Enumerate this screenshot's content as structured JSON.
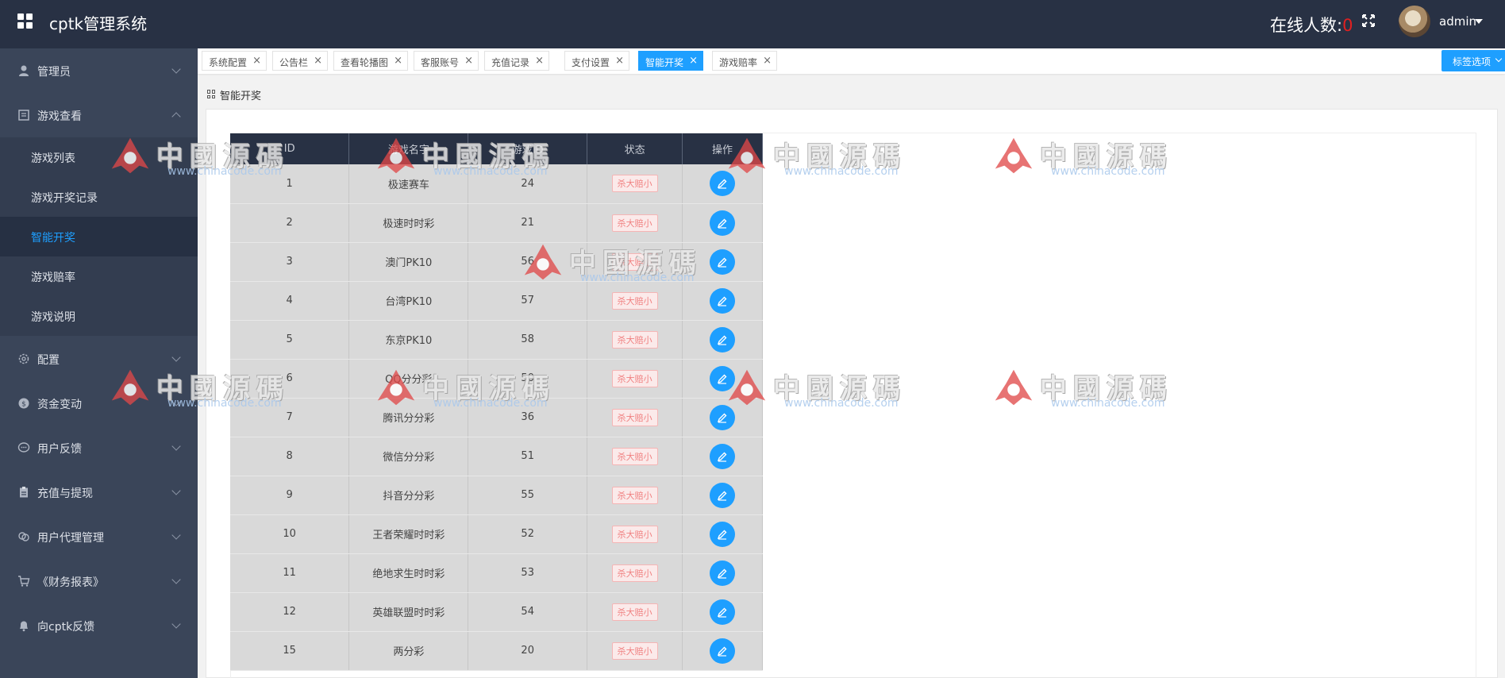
{
  "header": {
    "title": "cptk管理系统",
    "online_label": "在线人数:",
    "online_count": "0",
    "user": "admin"
  },
  "sidebar": {
    "items": [
      {
        "label": "管理员",
        "icon": "user-icon"
      },
      {
        "label": "游戏查看",
        "icon": "book-icon",
        "expanded": true,
        "children": [
          {
            "label": "游戏列表"
          },
          {
            "label": "游戏开奖记录"
          },
          {
            "label": "智能开奖",
            "active": true
          },
          {
            "label": "游戏赔率"
          },
          {
            "label": "游戏说明"
          }
        ]
      },
      {
        "label": "配置",
        "icon": "gear-icon"
      },
      {
        "label": "资金变动",
        "icon": "coin-icon"
      },
      {
        "label": "用户反馈",
        "icon": "chat-icon"
      },
      {
        "label": "充值与提现",
        "icon": "clipboard-icon"
      },
      {
        "label": "用户代理管理",
        "icon": "link-icon"
      },
      {
        "label": "《财务报表》",
        "icon": "cart-icon"
      },
      {
        "label": "向cptk反馈",
        "icon": "bell-icon"
      }
    ]
  },
  "tabs": [
    {
      "label": "系统配置"
    },
    {
      "label": "公告栏"
    },
    {
      "label": "查看轮播图"
    },
    {
      "label": "客服账号"
    },
    {
      "label": "充值记录"
    },
    {
      "label": "支付设置"
    },
    {
      "label": "智能开奖",
      "active": true
    },
    {
      "label": "游戏赔率"
    }
  ],
  "tab_options_label": "标签选项",
  "breadcrumb": "智能开奖",
  "table": {
    "headers": [
      "ID",
      "游戏名字",
      "游戏ID",
      "状态",
      "操作"
    ],
    "rows": [
      {
        "id": "1",
        "name": "极速赛车",
        "game_id": "24",
        "status": "杀大赔小"
      },
      {
        "id": "2",
        "name": "极速时时彩",
        "game_id": "21",
        "status": "杀大赔小"
      },
      {
        "id": "3",
        "name": "澳门PK10",
        "game_id": "56",
        "status": "杀大赔小"
      },
      {
        "id": "4",
        "name": "台湾PK10",
        "game_id": "57",
        "status": "杀大赔小"
      },
      {
        "id": "5",
        "name": "东京PK10",
        "game_id": "58",
        "status": "杀大赔小"
      },
      {
        "id": "6",
        "name": "QQ分分彩",
        "game_id": "50",
        "status": "杀大赔小"
      },
      {
        "id": "7",
        "name": "腾讯分分彩",
        "game_id": "36",
        "status": "杀大赔小"
      },
      {
        "id": "8",
        "name": "微信分分彩",
        "game_id": "51",
        "status": "杀大赔小"
      },
      {
        "id": "9",
        "name": "抖音分分彩",
        "game_id": "55",
        "status": "杀大赔小"
      },
      {
        "id": "10",
        "name": "王者荣耀时时彩",
        "game_id": "52",
        "status": "杀大赔小"
      },
      {
        "id": "11",
        "name": "绝地求生时时彩",
        "game_id": "53",
        "status": "杀大赔小"
      },
      {
        "id": "12",
        "name": "英雄联盟时时彩",
        "game_id": "54",
        "status": "杀大赔小"
      },
      {
        "id": "15",
        "name": "两分彩",
        "game_id": "20",
        "status": "杀大赔小"
      }
    ]
  },
  "watermark": {
    "text": "中國源碼",
    "url": "www.chinacode.com"
  },
  "colors": {
    "header_bg": "#283144",
    "sidebar_bg": "#3a4559",
    "accent": "#1e9fff",
    "danger": "#e02020"
  }
}
